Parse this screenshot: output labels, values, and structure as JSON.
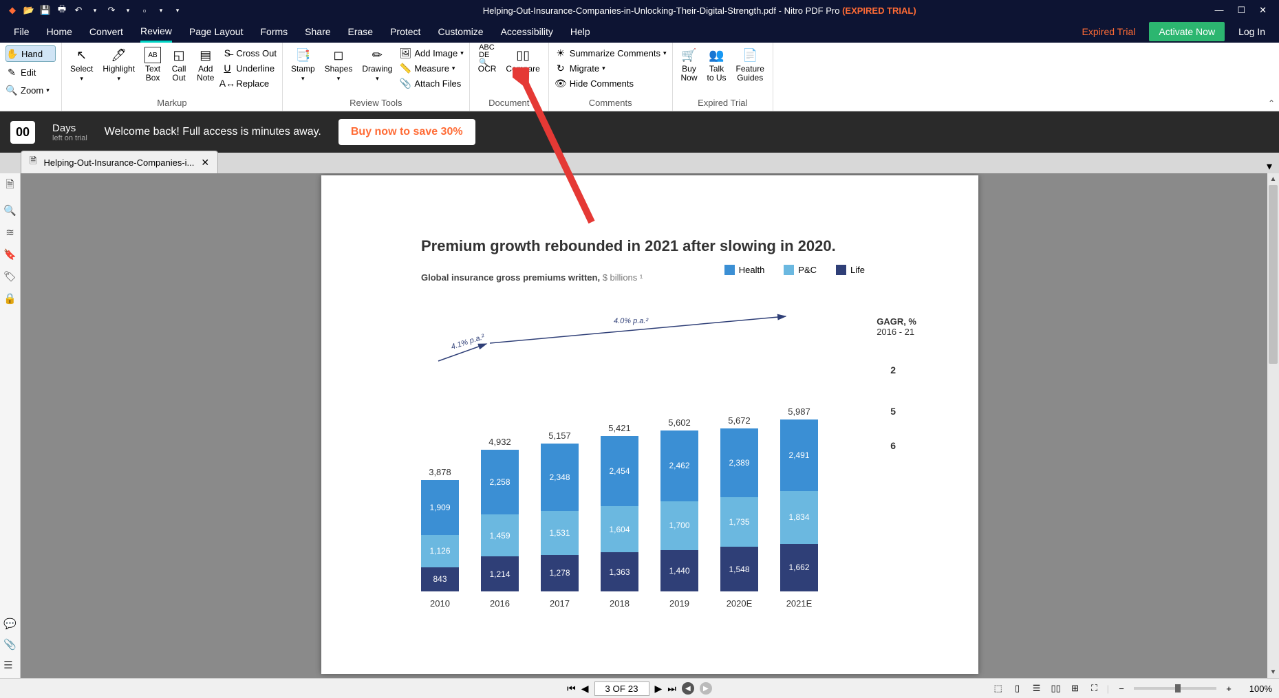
{
  "titlebar": {
    "filename": "Helping-Out-Insurance-Companies-in-Unlocking-Their-Digital-Strength.pdf",
    "app": "Nitro PDF Pro",
    "expired": "(EXPIRED TRIAL)"
  },
  "menu": {
    "file": "File",
    "home": "Home",
    "convert": "Convert",
    "review": "Review",
    "page_layout": "Page Layout",
    "forms": "Forms",
    "share": "Share",
    "erase": "Erase",
    "protect": "Protect",
    "customize": "Customize",
    "accessibility": "Accessibility",
    "help": "Help",
    "expired_trial": "Expired Trial",
    "activate": "Activate Now",
    "login": "Log In"
  },
  "ribbon": {
    "hand": "Hand",
    "edit": "Edit",
    "zoom": "Zoom",
    "select": "Select",
    "highlight": "Highlight",
    "text_box": "Text\nBox",
    "call_out": "Call\nOut",
    "add_note": "Add\nNote",
    "cross_out": "Cross Out",
    "underline": "Underline",
    "replace": "Replace",
    "markup": "Markup",
    "stamp": "Stamp",
    "shapes": "Shapes",
    "drawing": "Drawing",
    "add_image": "Add Image",
    "measure": "Measure",
    "attach": "Attach Files",
    "review_tools": "Review Tools",
    "ocr": "OCR",
    "compare": "Compare",
    "document": "Document",
    "summarize": "Summarize Comments",
    "migrate": "Migrate",
    "hide": "Hide Comments",
    "comments": "Comments",
    "buy_now": "Buy\nNow",
    "talk": "Talk\nto Us",
    "feature": "Feature\nGuides",
    "expired_group": "Expired Trial"
  },
  "banner": {
    "days": "00",
    "days_label": "Days",
    "left": "left on trial",
    "welcome": "Welcome back! Full access is minutes away.",
    "buy": "Buy now to save 30%"
  },
  "tab": {
    "name": "Helping-Out-Insurance-Companies-i..."
  },
  "statusbar": {
    "page": "3 OF 23",
    "zoom": "100%"
  },
  "chart_data": {
    "type": "bar",
    "title": "Premium growth rebounded in 2021 after slowing in 2020.",
    "subtitle_bold": "Global insurance gross premiums written,",
    "subtitle_light": " $ billions ¹",
    "legend": [
      {
        "name": "Health",
        "color": "#3b8fd4"
      },
      {
        "name": "P&C",
        "color": "#6bb8e0"
      },
      {
        "name": "Life",
        "color": "#2f3f77"
      }
    ],
    "categories": [
      "2010",
      "2016",
      "2017",
      "2018",
      "2019",
      "2020E",
      "2021E"
    ],
    "series": [
      {
        "name": "Life",
        "values": [
          843,
          1214,
          1278,
          1363,
          1440,
          1548,
          1662
        ]
      },
      {
        "name": "P&C",
        "values": [
          1126,
          1459,
          1531,
          1604,
          1700,
          1735,
          1834
        ]
      },
      {
        "name": "Health",
        "values": [
          1909,
          2258,
          2348,
          2454,
          2462,
          2389,
          2491
        ]
      }
    ],
    "totals": [
      3878,
      4932,
      5157,
      5421,
      5602,
      5672,
      5987
    ],
    "gagr_label": "GAGR, %",
    "gagr_period": "2016 - 21",
    "gagr_values": [
      "2",
      "5",
      "6"
    ],
    "trend_labels": [
      "4.1% p.a.²",
      "4.0% p.a.²"
    ],
    "ylim": [
      0,
      6000
    ]
  }
}
